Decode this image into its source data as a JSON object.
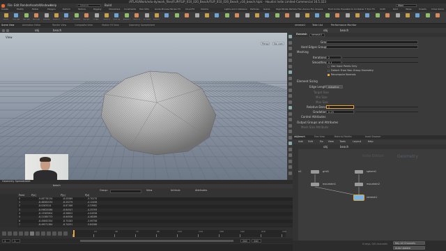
{
  "window": {
    "title": "/ATLAS/Work/edu-dy/work_files/FLIP/FLIP_010_020_Beach/FLIP_010_020_Beach_v16_beach.hiplc - Houdini Indie Limited-Commercial 16.5.323"
  },
  "menu": {
    "items": [
      "File",
      "Edit",
      "Render",
      "Assets",
      "Windows",
      "Help"
    ],
    "search": "Search",
    "build": "Build",
    "desktop": "Main"
  },
  "shelf": {
    "tabs": [
      "Create",
      "Modify",
      "Model",
      "Polygon",
      "Deform",
      "Texture",
      "Rigging",
      "Characters",
      "Constraints",
      "Hair Utils",
      "Guide Process",
      "Terrain FX",
      "Cloud FX",
      "Volume"
    ],
    "tabs2": [
      "Lights and Cameras",
      "Collisions",
      "Particles",
      "Grains",
      "Rigid Bodies",
      "Particle Fluids",
      "Viscous Fluids",
      "Oceans",
      "Fluid Containers",
      "Populate Containers",
      "Container Tools",
      "Pyro FX",
      "Cloth",
      "Solid",
      "Wires",
      "Crowds",
      "Drive Simulation"
    ],
    "tools": [
      "Camera",
      "Point Light",
      "Spot Light",
      "Area Light",
      "Geometry Light",
      "Volume Light",
      "Distant Light",
      "Environment Light",
      "Sky Light",
      "GI Light",
      "Caustic Light",
      "Portal Light",
      "Ambient Light",
      "Stereo Camera",
      "VR Camera",
      "Switcher"
    ]
  },
  "viewport": {
    "tabs": [
      "Scene View",
      "Animation Editor",
      "Render View",
      "Composite View",
      "Motion FX View",
      "Geometry Spreadsheet"
    ],
    "path": "obj",
    "node": "beach",
    "label": "View",
    "persp": "Persp",
    "cam": "No cam"
  },
  "spreadsheet": {
    "tab": "Geometry Spreadsheet",
    "node": "beach",
    "group_label": "Group:",
    "view_label": "View",
    "intrinsic": "Intrinsic",
    "attributes": "Attributes",
    "columns": [
      "Point",
      "P[x]",
      "P[y]",
      "P[z]"
    ],
    "rows": [
      [
        "0",
        "-9.08778134",
        "-8.05589",
        "-3.70275"
      ],
      [
        "1",
        "-8.48582034",
        "-8.25279",
        "-4.12456"
      ],
      [
        "2",
        "-8.0283524",
        "-8.87186",
        "-4.33982"
      ],
      [
        "3",
        "-8.09825086",
        "-8.84547",
        "-4.25793"
      ],
      [
        "4",
        "-8.13383804",
        "-8.56822",
        "-4.04556"
      ],
      [
        "5",
        "-8.21385773",
        "-8.64556",
        "-4.48289"
      ],
      [
        "6",
        "-8.45892354",
        "-8.75283",
        "-3.99756"
      ],
      [
        "7",
        "-8.49571384",
        "-8.74251",
        "-3.84286"
      ]
    ]
  },
  "timeline": {
    "frame": "1",
    "start": "1",
    "end": "240",
    "end2": "240",
    "auto_update": "Auto Update",
    "ticks": [
      "1",
      "24",
      "48",
      "72",
      "96",
      "120",
      "144",
      "168",
      "192",
      "216",
      "240"
    ]
  },
  "params": {
    "tabs": [
      "remesh1",
      "Take List",
      "Performance Monitor"
    ],
    "path": "obj",
    "node": "beach",
    "type": "Remesh",
    "node_name": "remesh1",
    "group_label": "Group",
    "hard_edges_label": "Hard Edges Group",
    "meshing_label": "Meshing",
    "iterations_label": "Iterations",
    "iterations_value": "2",
    "smoothing_label": "Smoothing",
    "smoothing_value": "0.1",
    "check1": "Use Input Points Only",
    "check2": "Detach From Non-Group Geometry",
    "check3": "Recompute Normals",
    "element_sizing": "Element Sizing",
    "edge_lengths_label": "Edge Lengths",
    "edge_lengths_value": "Adaptive",
    "target_size_label": "Target Size",
    "min_size_label": "Min Size",
    "max_size_label": "Max Size",
    "relative_density_label": "Relative Density",
    "relative_density_value": "2",
    "gradation_label": "Gradation",
    "gradation_value": "0.25",
    "control_attributes": "Control Attributes",
    "output_groups": "Output Groups and Attributes",
    "mesh_size_label": "Mesh Size Attribute"
  },
  "network": {
    "tabs": [
      "obj/beach",
      "Tree View",
      "Material Palette",
      "Asset Browser"
    ],
    "menu": [
      "Add",
      "Edit",
      "Go",
      "View",
      "Tools",
      "Layout",
      "Help"
    ],
    "path": "obj",
    "node": "beach",
    "context_label": "Indie Edition",
    "context_type": "Geometry",
    "nodes": [
      {
        "name": "box1",
        "label": "",
        "color": "#9a9a9a"
      },
      {
        "name": "grid1",
        "label": "grid1",
        "color": "#9a9a9a"
      },
      {
        "name": "sphere1",
        "label": "sphere1",
        "color": "#9a9a9a"
      },
      {
        "name": "mountain1",
        "label": "mountain1",
        "color": "#9a9a9a"
      },
      {
        "name": "mountain2",
        "label": "mountain2",
        "color": "#9a9a9a"
      },
      {
        "name": "remesh1",
        "label": "remesh1",
        "color": "#7ab3e0"
      }
    ],
    "light_label": "beach"
  },
  "status": {
    "left": "0",
    "right": "Forced_Out: None",
    "keys": "0 keys, 0/0 channels",
    "key_all": "Key All Channels",
    "auto_update": "Auto Update"
  },
  "colors": {
    "accent": "#e8a83c",
    "bg": "#3a3a3a",
    "panel": "#2b2b2b",
    "viewport_top": "#b9c1c9",
    "viewport_bottom": "#6f7a86"
  }
}
